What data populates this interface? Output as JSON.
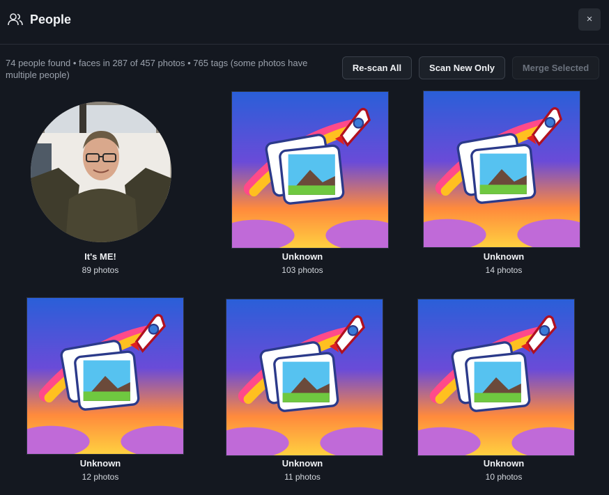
{
  "header": {
    "title": "People",
    "close_label": "×"
  },
  "summary": "74 people found • faces in 287 of 457 photos • 765 tags (some photos have multiple people)",
  "toolbar": {
    "rescan_label": "Re-scan All",
    "scan_new_label": "Scan New Only",
    "merge_label": "Merge Selected"
  },
  "people": [
    {
      "name": "It's ME!",
      "count": "89 photos",
      "thumb": "person-photo"
    },
    {
      "name": "Unknown",
      "count": "103 photos",
      "thumb": "rocket-photos-icon"
    },
    {
      "name": "Unknown",
      "count": "14 photos",
      "thumb": "rocket-photos-icon"
    },
    {
      "name": "Unknown",
      "count": "12 photos",
      "thumb": "rocket-photos-icon"
    },
    {
      "name": "Unknown",
      "count": "11 photos",
      "thumb": "rocket-photos-icon"
    },
    {
      "name": "Unknown",
      "count": "10 photos",
      "thumb": "rocket-photos-icon"
    }
  ],
  "colors": {
    "background": "#141820",
    "accent_orange": "#ffb020",
    "accent_purple": "#6a4bd8"
  }
}
